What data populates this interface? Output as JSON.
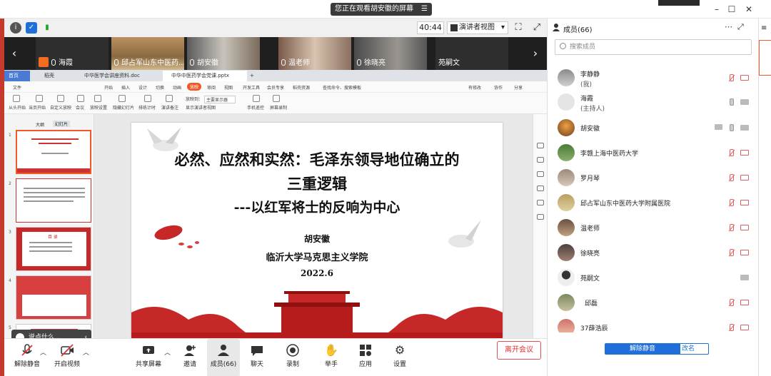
{
  "top_bar": {
    "viewing_text": "您正在观看胡安徽的屏幕",
    "menu_icon": "menu-icon",
    "window_controls": [
      "minimize-icon",
      "maximize-icon",
      "close-icon"
    ]
  },
  "status_bar": {
    "timer": "40:44",
    "view_mode": "演讲者视图",
    "icons": [
      "info-icon",
      "shield-icon",
      "signal-icon",
      "fit-icon",
      "fullscreen-icon"
    ]
  },
  "video_strip": {
    "tiles": [
      {
        "name": "海霞",
        "host": true
      },
      {
        "name": "邱占军山东中医药...",
        "host": false
      },
      {
        "name": "胡安徽",
        "host": false
      },
      {
        "name": "温老师",
        "host": false
      },
      {
        "name": "徐晓亮",
        "host": false
      },
      {
        "name": "苑嗣文",
        "host": false
      }
    ]
  },
  "wps": {
    "tabs": [
      "首页",
      "稻壳",
      "中华医学会讲座资料.doc",
      "中华中医药学会党课.pptx"
    ],
    "menu": [
      "文件",
      "开始",
      "插入",
      "设计",
      "切换",
      "动画",
      "放映",
      "审阅",
      "视图",
      "开发工具",
      "会员专享",
      "稻壳资源",
      "查找命令、搜索模板",
      "有修改",
      "协作",
      "分享"
    ],
    "active_menu": "放映",
    "ribbon": [
      "从头开始",
      "当页开始",
      "自定义放映",
      "会议",
      "放映设置",
      "隐藏幻灯片",
      "排练计时",
      "演讲备注",
      "放映到：",
      "主要显示器",
      "显示演讲者视图",
      "手机遥控",
      "屏幕录制"
    ],
    "panel_tabs": [
      "大纲",
      "幻灯片"
    ],
    "slide": {
      "title_line1": "必然、应然和实然：毛泽东领导地位确立的",
      "title_line2": "三重逻辑",
      "title_line3": "---以红军将士的反响为中心",
      "author": "胡安徽",
      "institution": "临沂大学马克思主义学院",
      "date": "2022.6"
    },
    "thumb_numbers": [
      "1",
      "2",
      "3",
      "4",
      "5"
    ],
    "thumb3_label": "目 录"
  },
  "chat_prompt": "说点什么...",
  "bottom_bar": {
    "buttons": [
      {
        "label": "解除静音",
        "icon": "mic-muted-icon"
      },
      {
        "label": "开启视频",
        "icon": "camera-off-icon"
      },
      {
        "label": "共享屏幕",
        "icon": "share-screen-icon"
      },
      {
        "label": "邀请",
        "icon": "invite-icon"
      },
      {
        "label": "成员(66)",
        "icon": "members-icon"
      },
      {
        "label": "聊天",
        "icon": "chat-icon"
      },
      {
        "label": "录制",
        "icon": "record-icon"
      },
      {
        "label": "举手",
        "icon": "raise-hand-icon"
      },
      {
        "label": "应用",
        "icon": "apps-icon"
      },
      {
        "label": "设置",
        "icon": "settings-icon"
      }
    ],
    "leave_label": "离开会议"
  },
  "members_panel": {
    "title": "成员(66)",
    "search_placeholder": "搜索成员",
    "members": [
      {
        "name": "李静静",
        "sub": "(我)",
        "mic": "muted",
        "cam": "off"
      },
      {
        "name": "海霞",
        "sub": "(主持人)",
        "mic": "on",
        "cam": "on"
      },
      {
        "name": "胡安徽",
        "sub": "",
        "mic": "on",
        "cam": "on",
        "sharing": true
      },
      {
        "name": "李赣上海中医药大学",
        "sub": "",
        "mic": "muted",
        "cam": "off"
      },
      {
        "name": "罗月琴",
        "sub": "",
        "mic": "muted",
        "cam": "off"
      },
      {
        "name": "邱占军山东中医药大学附属医院",
        "sub": "",
        "mic": "muted",
        "cam": "off"
      },
      {
        "name": "温老师",
        "sub": "",
        "mic": "muted",
        "cam": "off"
      },
      {
        "name": "徐晓亮",
        "sub": "",
        "mic": "muted",
        "cam": "off"
      },
      {
        "name": "苑嗣文",
        "sub": "",
        "mic": "none",
        "cam": "on"
      },
      {
        "name": "邱磊",
        "sub": "",
        "mic": "muted",
        "cam": "off"
      },
      {
        "name": "37薛浩辰",
        "sub": "",
        "mic": "muted",
        "cam": "off"
      }
    ],
    "unmute_all": "解除静音",
    "rename": "改名"
  },
  "colors": {
    "accent_blue": "#1e6fd9",
    "wps_orange": "#f05a28",
    "leave_red": "#e03030",
    "muted_red": "#e06060",
    "slide_red": "#b71c1c"
  }
}
